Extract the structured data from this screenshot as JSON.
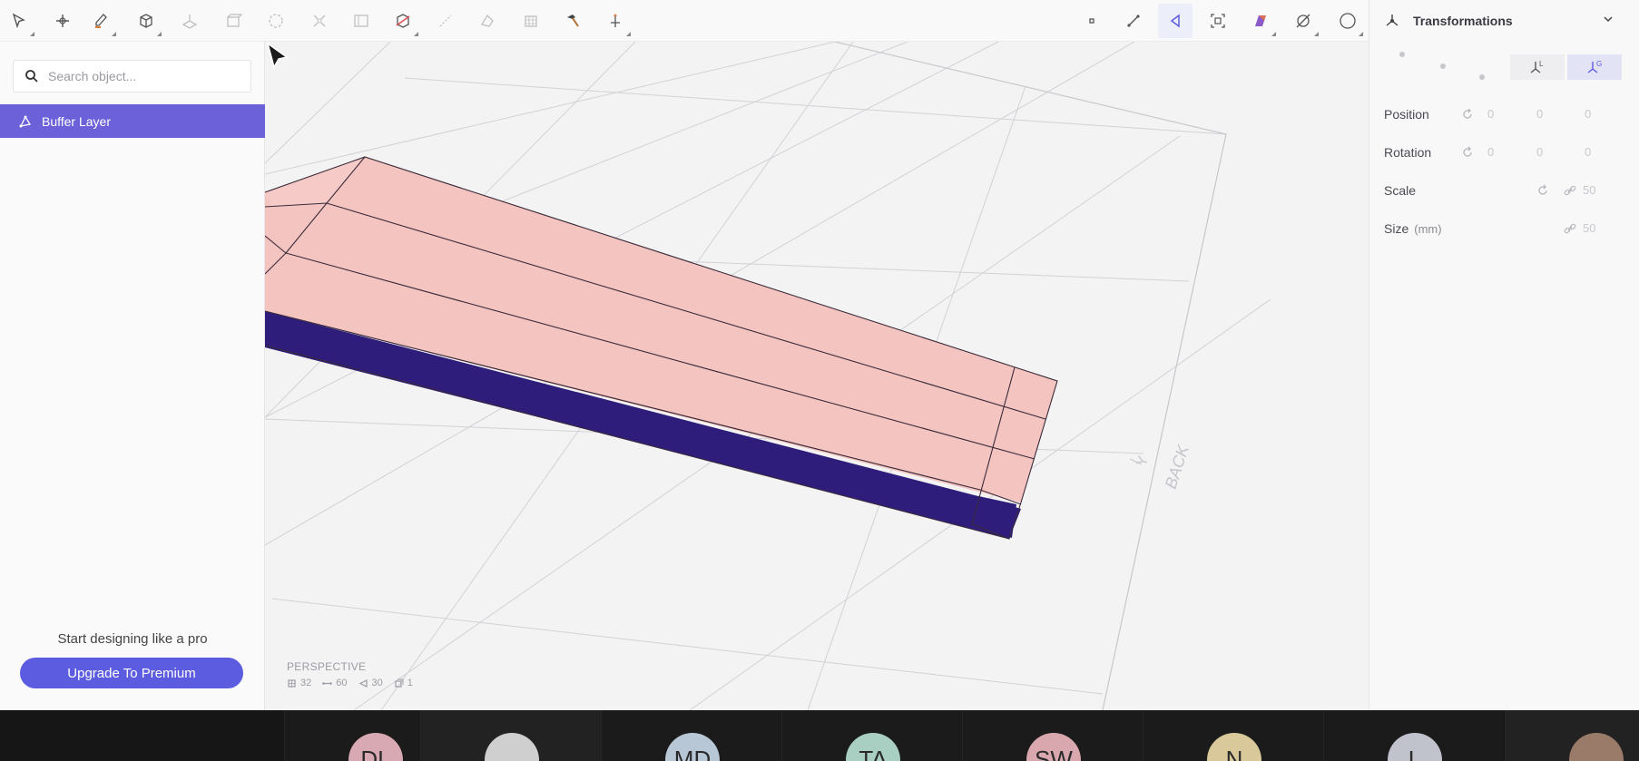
{
  "sidebar": {
    "search_placeholder": "Search object...",
    "layer_name": "Buffer Layer",
    "promo_text": "Start designing like a pro",
    "upgrade_label": "Upgrade To Premium"
  },
  "viewport": {
    "view_label": "PERSPECTIVE",
    "axis_label": "Y",
    "back_label": "BACK",
    "stats": {
      "vertices": "32",
      "edges": "60",
      "faces": "30",
      "objects": "1"
    }
  },
  "right_panel": {
    "title": "Transformations",
    "position_label": "Position",
    "rotation_label": "Rotation",
    "scale_label": "Scale",
    "size_label": "Size",
    "size_unit": "(mm)",
    "position_values": [
      "0",
      "0",
      "0"
    ],
    "rotation_values": [
      "0",
      "0",
      "0"
    ],
    "scale_value": "50",
    "size_value": "50",
    "local_mode_label": "L",
    "global_mode_label": "G"
  },
  "participants": [
    {
      "initials": "DL",
      "color": "#d8a9b2"
    },
    {
      "initials": "",
      "color": "#cfcfcf"
    },
    {
      "initials": "MD",
      "color": "#b7c7d6"
    },
    {
      "initials": "TA",
      "color": "#a9cfc2"
    },
    {
      "initials": "SW",
      "color": "#d9a7ae"
    },
    {
      "initials": "N",
      "color": "#d8c89a"
    },
    {
      "initials": "L",
      "color": "#c0c3cc"
    },
    {
      "initials": "",
      "color": "#9a7b69"
    }
  ],
  "colors": {
    "accent": "#6c61d9",
    "button": "#5c5ce0",
    "top_face": "#f4c4c0",
    "side_face": "#2e1d7a"
  }
}
